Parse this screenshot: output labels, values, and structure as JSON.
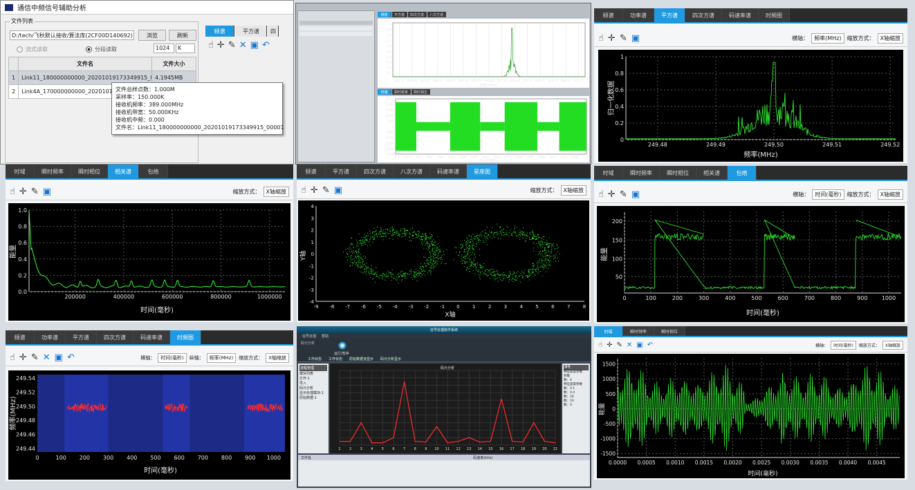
{
  "colors": {
    "accent": "#1f9ae0",
    "trace": "#33ff33",
    "redtrace": "#ff2b2b"
  },
  "fileapp": {
    "title": "通信中频信号辅助分析",
    "group": "文件列表",
    "path": "D:/tech/飞秋默认接收/算法库(2CF00D140692)",
    "browse": "浏览",
    "refresh": "刷新",
    "mode_stream": "流式读取",
    "mode_block": "分段读取",
    "blocksize": "1024",
    "blockunit": "K",
    "headers": [
      "文件名",
      "文件大小"
    ],
    "rows": [
      {
        "idx": "1",
        "name": "Link11_180000000000_20201019173349915_0…",
        "size": "4.1945MB"
      },
      {
        "idx": "2",
        "name": "Link4A_170000000000_20201019110153…",
        "size": ""
      }
    ],
    "tooltip": [
      "文件总样点数：1.000M",
      "采样率：150.000K",
      "接收机频率：389.000MHz",
      "接收机带宽：50.000KHz",
      "接收机中频：0.000",
      "文件名：Link11_180000000000_20201019173349915_00001"
    ],
    "tabs": [
      "频谱",
      "平方谱",
      "四"
    ]
  },
  "mini_app": {
    "tabs": [
      "频谱",
      "平方谱",
      "四次方谱",
      "八次方谱"
    ],
    "spec_ticks": [
      "388.93",
      "388.94",
      "388.95",
      "388.96",
      "388.97",
      "388.98",
      "388.99",
      "389.00",
      "389.01",
      "389.02",
      "389.03",
      "389.04",
      "389.05",
      "389.06",
      "389.07"
    ],
    "spec_y": [
      "1",
      "0.9",
      "0.8",
      "0.7",
      "0.6",
      "0.5",
      "0.4",
      "0.3",
      "0.2",
      "0.1"
    ],
    "spec_xlabel": "频率(MHz)",
    "time_tabs": [
      "时域",
      "瞬时频率",
      "瞬时相位"
    ],
    "time_y": [
      "25000",
      "20000",
      "15000",
      "10000",
      "5000",
      "0",
      "-5000",
      "-10000",
      "-15000",
      "-20000",
      "-25000"
    ],
    "time_x": [
      "0",
      "200",
      "400",
      "600",
      "800",
      "1000",
      "1200",
      "1400",
      "1600",
      "1800",
      "2000",
      "2200",
      "2400",
      "2600",
      "2800",
      "3000",
      "3200",
      "3400"
    ],
    "time_xlabel": "时间(毫秒)"
  },
  "tr": {
    "tabs": [
      "频谱",
      "功率谱",
      "平方谱",
      "四次方谱",
      "码速率谱",
      "时频图"
    ],
    "xaxis_label": "横轴：",
    "xaxis_val": "频率(MHz)",
    "scale_label": "缩放方式：",
    "scale_val": "X轴缩放",
    "ylabel": "归一化数据",
    "xlabel": "频率(MHz)",
    "xticks": [
      "249.48",
      "249.49",
      "249.50",
      "249.51",
      "249.52"
    ],
    "yticks": [
      "1",
      "0.8",
      "0.6",
      "0.4",
      "0.2",
      "0"
    ]
  },
  "ml": {
    "tabs": [
      "时域",
      "瞬时频率",
      "瞬时相位",
      "相关谱",
      "包络"
    ],
    "scale_label": "缩放方式：",
    "scale_val": "X轴缩放",
    "ylabel": "能量",
    "xlabel": "时间(毫秒)",
    "xticks": [
      "200000",
      "400000",
      "600000",
      "800000",
      "1000000"
    ],
    "yticks": [
      "1.0",
      "0.8",
      "0.6",
      "0.4",
      "0.2",
      "0.0"
    ]
  },
  "mc": {
    "tabs": [
      "频谱",
      "平方谱",
      "四次方谱",
      "八次方谱",
      "码速率谱",
      "星座图"
    ],
    "scale_label": "缩放方式：",
    "scale_val": "X轴缩放",
    "ylabel": "Y轴",
    "xlabel": "X轴",
    "xticks": [
      "-9",
      "-8",
      "-7",
      "-6",
      "-5",
      "-4",
      "-3",
      "-2",
      "-1",
      "0",
      "1",
      "2",
      "3",
      "4",
      "5",
      "6",
      "7",
      "8"
    ],
    "yticks": [
      "4",
      "3",
      "2",
      "1",
      "0",
      "-1",
      "-2",
      "-3",
      "-4"
    ]
  },
  "mr": {
    "tabs": [
      "时域",
      "瞬时频率",
      "瞬时相位",
      "相关谱",
      "包络"
    ],
    "xaxis_label": "横轴：",
    "xaxis_val": "时间(毫秒)",
    "scale_label": "缩放方式：",
    "scale_val": "X轴缩放",
    "ylabel": "能量",
    "xlabel": "时间(毫秒)",
    "xticks": [
      "0",
      "100",
      "200",
      "300",
      "400",
      "500",
      "600",
      "700",
      "800",
      "900",
      "1000"
    ],
    "yticks": [
      "200",
      "150",
      "100",
      "50"
    ]
  },
  "bl": {
    "tabs": [
      "频谱",
      "功率谱",
      "平方谱",
      "四次方谱",
      "码速率谱",
      "时频图"
    ],
    "xaxis_label": "横轴：",
    "xaxis_val": "时间(毫秒)",
    "yaxis_label": "纵轴：",
    "yaxis_val": "频率(MHz)",
    "scale_label": "缩放方式：",
    "scale_val": "X轴缩放",
    "ylabel": "频率(MHz)",
    "xlabel": "时间(毫秒)",
    "xticks": [
      "0",
      "100",
      "200",
      "300",
      "400",
      "500",
      "600",
      "700",
      "800",
      "900",
      "1000"
    ],
    "yticks": [
      "249.54",
      "249.52",
      "249.50",
      "249.48",
      "249.46",
      "249.44"
    ]
  },
  "bc": {
    "title": "信号处理软件系统",
    "menu": [
      "信号处理",
      "帮助"
    ],
    "section": "码元分析",
    "tabs": [
      "工作状态",
      "工作状态",
      "原始数据流显示",
      "码元分析显示"
    ],
    "left_title": "流程管理",
    "left_items": [
      "模块列表",
      "打开-1",
      "导入",
      "码元分析",
      "显示处理模块-1",
      "原始数据-1"
    ],
    "chart_title": "码元分析",
    "xticks": [
      "1",
      "2",
      "3",
      "4",
      "5",
      "6",
      "7",
      "8",
      "9",
      "10",
      "11",
      "12",
      "13",
      "14",
      "15",
      "16",
      "17",
      "18",
      "19",
      "20",
      "21"
    ],
    "right_title": "属性",
    "right_items": [
      "特征提取参数",
      "参数",
      "数：4",
      "特征提取参数",
      "数：0.1",
      "数：0.4",
      "数：16",
      "数：10",
      "数：0"
    ],
    "bottom_cols": [
      "文件名",
      "码速率(kHz)"
    ],
    "status": "运行/暂停"
  },
  "br": {
    "tabs": [
      "时域",
      "瞬时频率",
      "瞬时相位"
    ],
    "xaxis_label": "横轴：",
    "xaxis_val": "时间(毫秒)",
    "scale_label": "缩放方式：",
    "scale_val": "X轴缩放",
    "ylabel": "能量",
    "xlabel": "时间(毫秒)",
    "xticks": [
      "0.0000",
      "0.0005",
      "0.0010",
      "0.0015",
      "0.0020",
      "0.0025",
      "0.0030",
      "0.0035",
      "0.0040",
      "0.0045"
    ],
    "yticks": [
      "1500",
      "1000",
      "500",
      "0",
      "-500",
      "-1000",
      "-1500"
    ]
  }
}
